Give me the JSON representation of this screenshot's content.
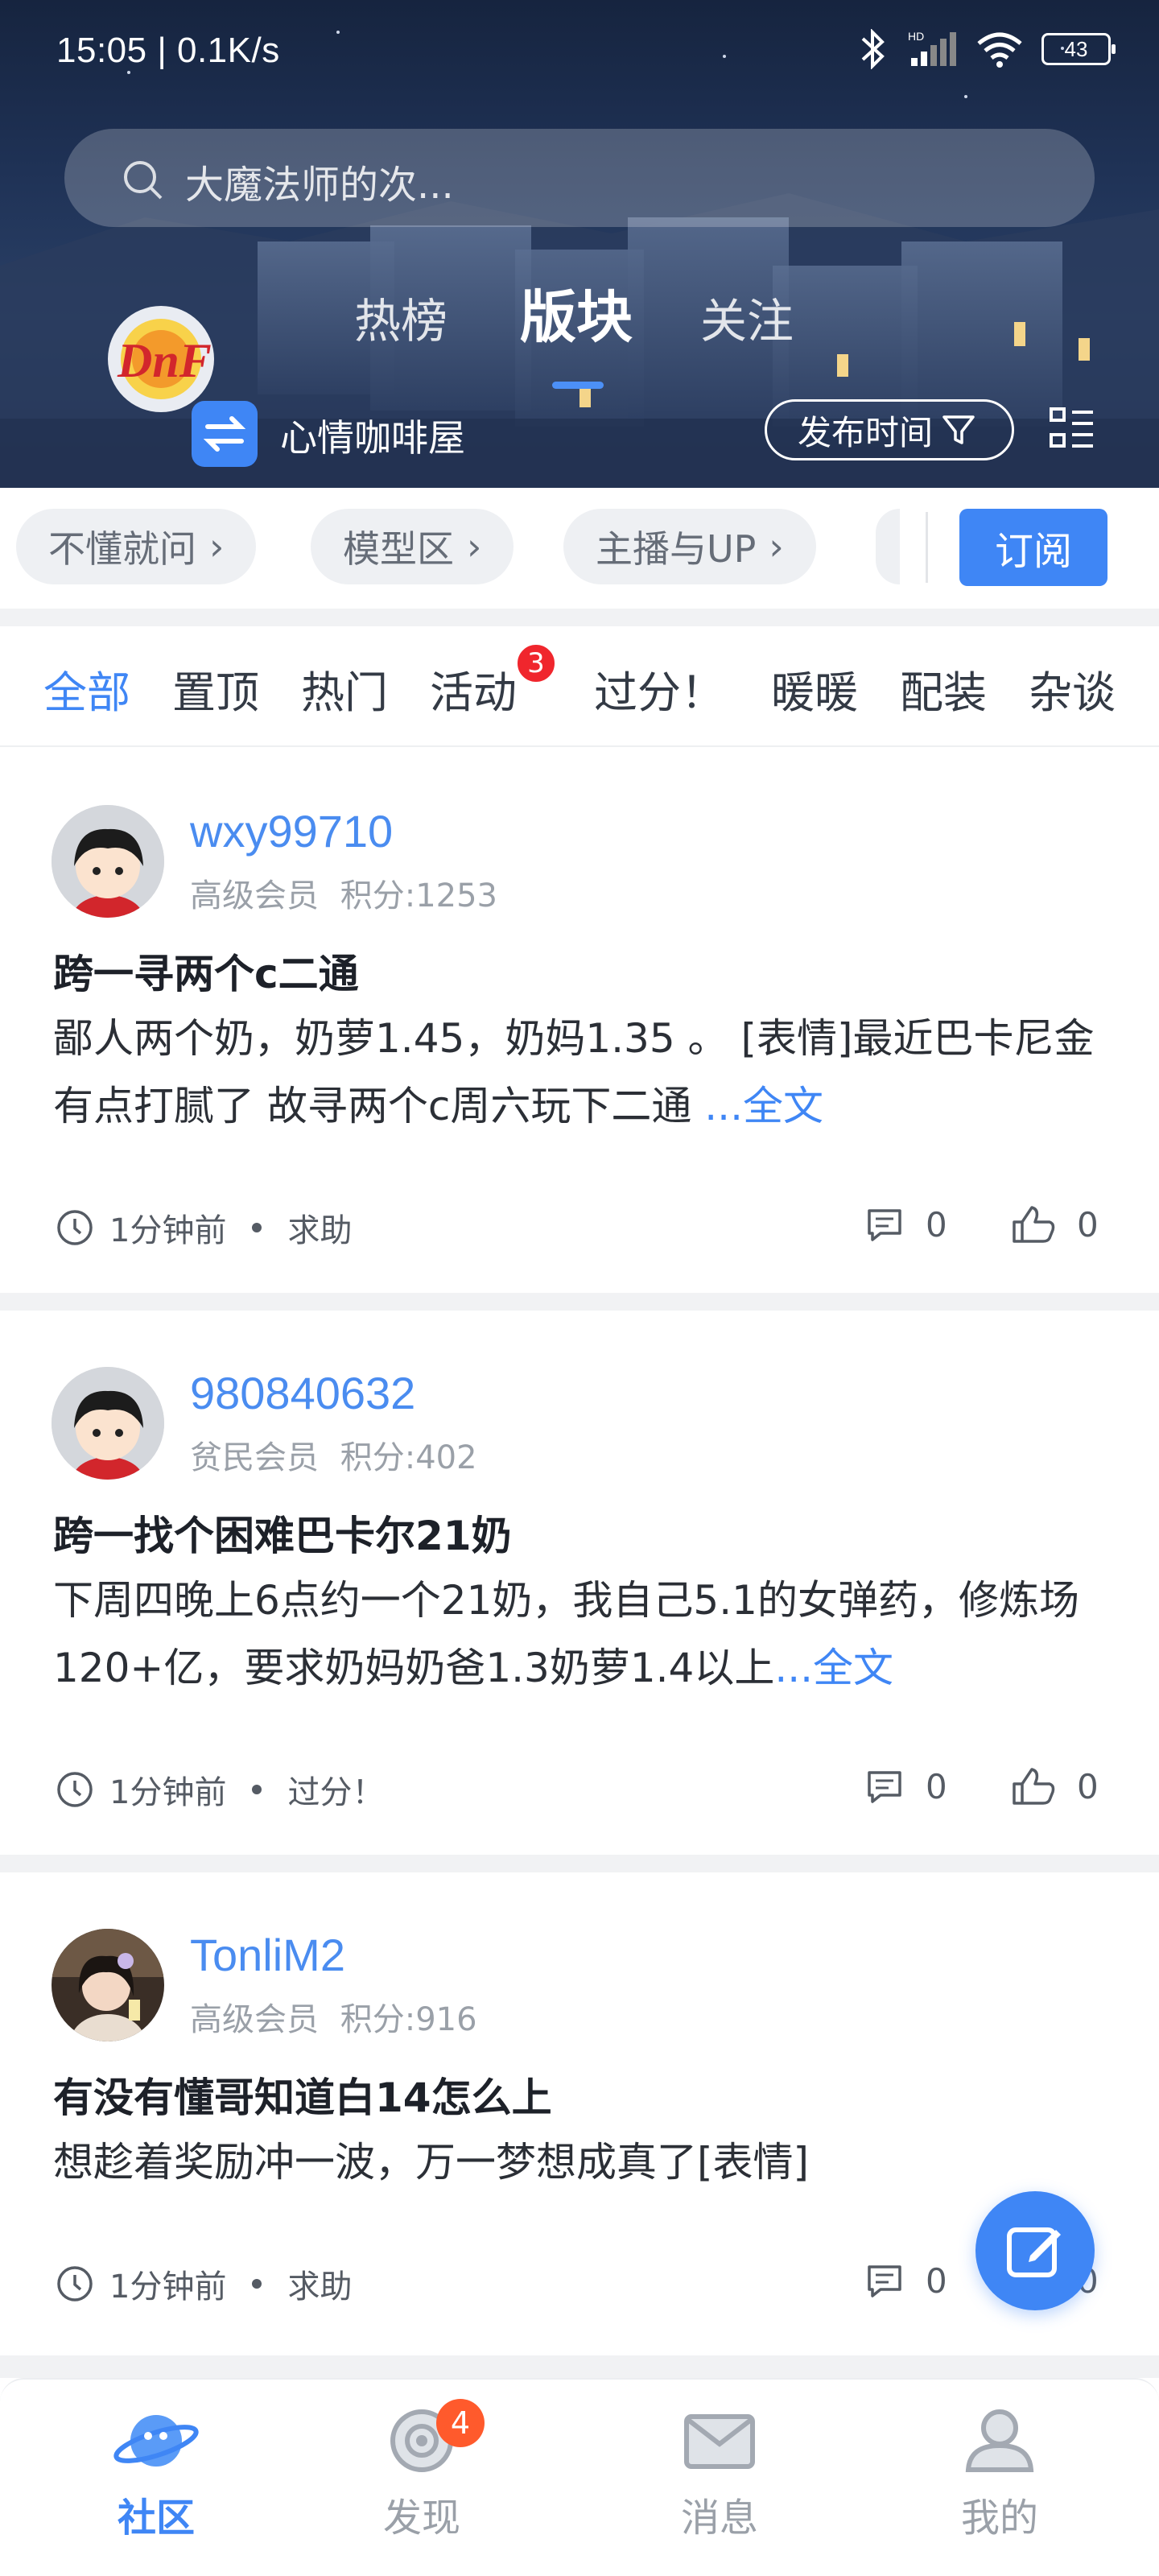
{
  "status_bar": {
    "time": "15:05 | 0.1K/s",
    "battery": "43",
    "network": "HD"
  },
  "search": {
    "placeholder": "大魔法师的次..."
  },
  "board": {
    "name": "心情咖啡屋",
    "logo_icon": "dnf-logo-icon"
  },
  "top_tabs": [
    {
      "label": "热榜",
      "active": false
    },
    {
      "label": "版块",
      "active": true
    },
    {
      "label": "关注",
      "active": false
    }
  ],
  "sort": {
    "label": "发布时间"
  },
  "categories": [
    {
      "label": "不懂就问"
    },
    {
      "label": "模型区"
    },
    {
      "label": "主播与UP"
    }
  ],
  "subscribe_label": "订阅",
  "filters": [
    {
      "label": "全部",
      "active": true
    },
    {
      "label": "置顶"
    },
    {
      "label": "热门"
    },
    {
      "label": "活动",
      "badge": "3"
    },
    {
      "label": "过分！"
    },
    {
      "label": "暖暖"
    },
    {
      "label": "配装"
    },
    {
      "label": "杂谈"
    }
  ],
  "posts": [
    {
      "username": "wxy99710",
      "rank": "高级会员",
      "points": "积分:1253",
      "title": "跨一寻两个c二通",
      "body": "鄙人两个奶，奶萝1.45，奶妈1.35 。 [表情]最近巴卡尼金有点打腻了  故寻两个c周六玩下二通  ",
      "more": "...全文",
      "time": "1分钟前",
      "tag": "求助",
      "comments": "0",
      "likes": "0"
    },
    {
      "username": "980840632",
      "rank": "贫民会员",
      "points": "积分:402",
      "title": "跨一找个困难巴卡尔21奶",
      "body": "下周四晚上6点约一个21奶，我自己5.1的女弹药，修炼场120+亿，要求奶妈奶爸1.3奶萝1.4以上",
      "more": "...全文",
      "time": "1分钟前",
      "tag": "过分！",
      "comments": "0",
      "likes": "0"
    },
    {
      "username": "TonliM2",
      "rank": "高级会员",
      "points": "积分:916",
      "title": "有没有懂哥知道白14怎么上",
      "body": "想趁着奖励冲一波，万一梦想成真了[表情]",
      "more": "",
      "time": "1分钟前",
      "tag": "求助",
      "comments": "0",
      "likes": "0"
    }
  ],
  "bottom_nav": [
    {
      "label": "社区",
      "active": true
    },
    {
      "label": "发现",
      "badge": "4"
    },
    {
      "label": "消息"
    },
    {
      "label": "我的"
    }
  ],
  "colors": {
    "accent": "#3f86f5",
    "badge_red": "#f0262d",
    "badge_orange": "#ff5a2c"
  }
}
